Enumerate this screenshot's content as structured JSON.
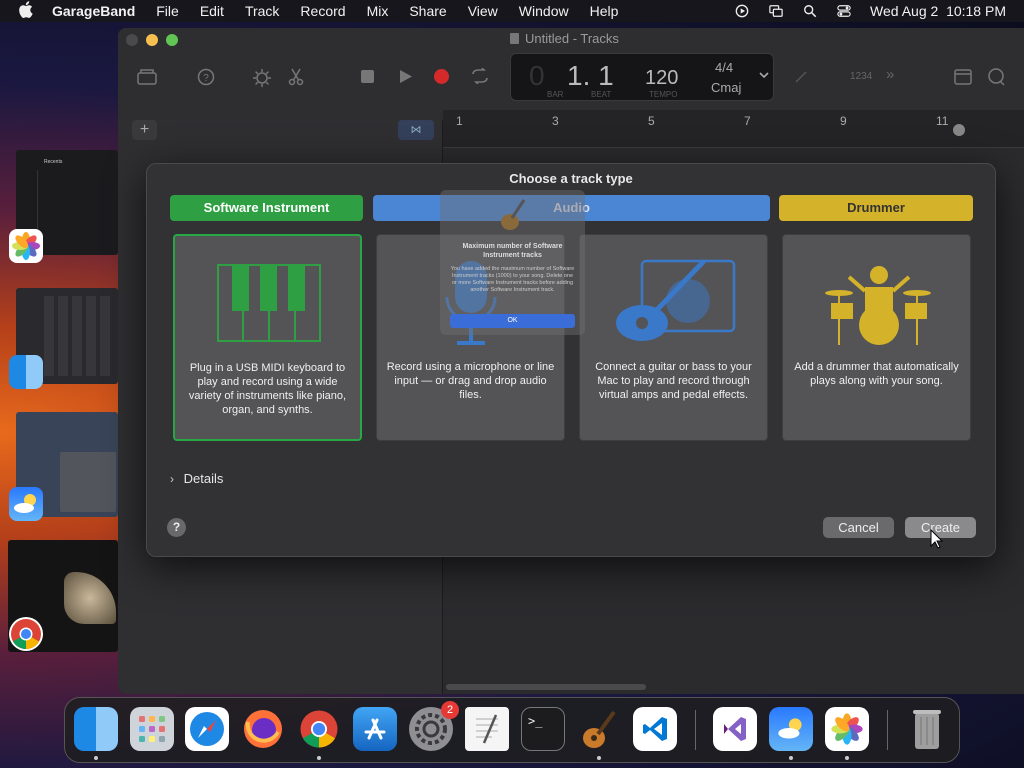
{
  "menubar": {
    "app_name": "GarageBand",
    "items": [
      "File",
      "Edit",
      "Track",
      "Record",
      "Mix",
      "Share",
      "View",
      "Window",
      "Help"
    ],
    "clock": "Wed Aug 2  10:18 PM"
  },
  "window": {
    "title": "Untitled - Tracks",
    "lcd": {
      "bar_beat": "1. 1",
      "bar_label": "BAR",
      "beat_label": "BEAT",
      "tempo": "120",
      "tempo_label": "TEMPO",
      "time_sig": "4/4",
      "key": "Cmaj"
    },
    "count_in": "1234",
    "ruler_marks": [
      "1",
      "3",
      "5",
      "7",
      "9",
      "11"
    ]
  },
  "dialog": {
    "title": "Choose a track type",
    "tabs": [
      {
        "label": "Software Instrument",
        "color": "#2ea043"
      },
      {
        "label": "Audio",
        "color": "#4a86d4"
      },
      {
        "label": "Drummer",
        "color": "#d4b32a"
      }
    ],
    "cards": [
      {
        "desc": "Plug in a USB MIDI keyboard to play and record using a wide variety of instruments like piano, organ, and synths."
      },
      {
        "desc": "Record using a microphone or line input — or drag and drop audio files."
      },
      {
        "desc": "Connect a guitar or bass to your Mac to play and record through virtual amps and pedal effects."
      },
      {
        "desc": "Add a drummer that automatically plays along with your song."
      }
    ],
    "details_label": "Details",
    "help_label": "?",
    "cancel_label": "Cancel",
    "create_label": "Create"
  },
  "alert_ghost": {
    "title": "Maximum number of Software Instrument tracks",
    "body": "You have added the maximum number of Software Instrument tracks (1000) to your song. Delete one or more Software Instrument tracks before adding another Software Instrument track.",
    "ok_label": "OK"
  },
  "stage_thumb_title": "Recents",
  "dock": {
    "settings_badge": "2"
  }
}
